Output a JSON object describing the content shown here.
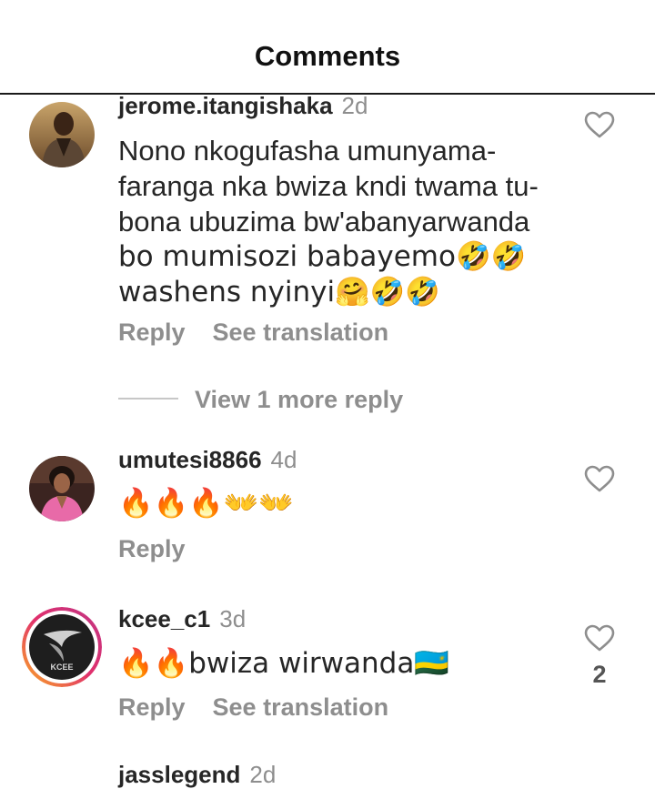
{
  "header": {
    "title": "Comments"
  },
  "comments": [
    {
      "username": "jerome.itangishaka",
      "age": "2d",
      "lines": [
        "Nono nkogufasha umunyama-",
        "faranga nka bwiza kndi  twama tu-",
        "bona ubuzima bw'abanyarwanda",
        "bo mumisozi babayemo🤣🤣",
        "washens nyinyi🤗🤣🤣"
      ],
      "reply": "Reply",
      "translate": "See translation",
      "more_replies": "View 1 more reply"
    },
    {
      "username": "umutesi8866",
      "age": "4d",
      "text": "🔥🔥🔥👐👐",
      "reply": "Reply"
    },
    {
      "username": "kcee_c1",
      "age": "3d",
      "text": "🔥🔥bwiza wirwanda🇷🇼",
      "reply": "Reply",
      "translate": "See translation",
      "likes": "2"
    }
  ],
  "partial": {
    "username": "jasslegend",
    "age": "2d"
  },
  "icons": {
    "like": "heart-outline-icon",
    "avatar_logo_text": "KCEE"
  },
  "colors": {
    "secondary_text": "#8e8e8e",
    "story_ring": "#e1306c"
  }
}
